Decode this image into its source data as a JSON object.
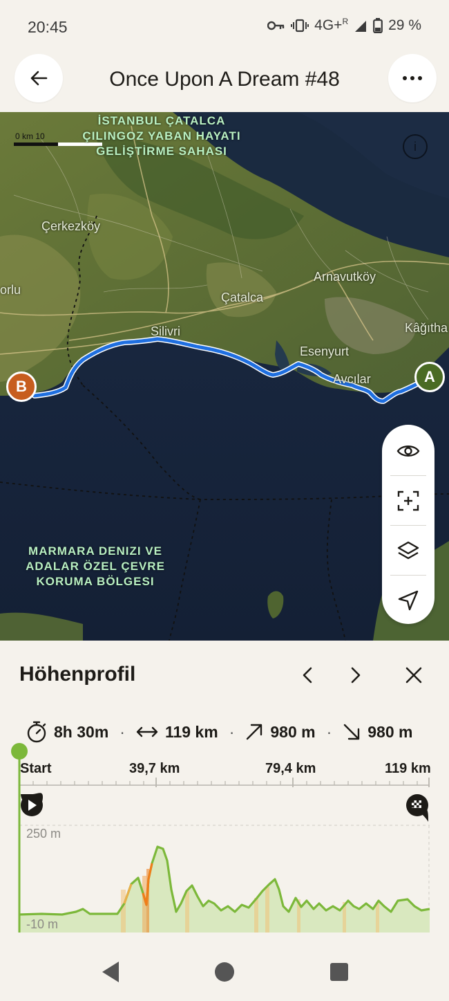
{
  "status_bar": {
    "time": "20:45",
    "network": "4G+",
    "roaming": "R",
    "battery": "29 %"
  },
  "header": {
    "title": "Once Upon A Dream #48"
  },
  "map": {
    "scale_label": "0 km   10",
    "labels": {
      "protected_area_north": "İSTANBUL ÇATALCA\nÇILINGOZ YABAN HAYATI\nGELİŞTİRME SAHASI",
      "protected_area_sea": "MARMARA DENIZI VE\nADALAR ÖZEL ÇEVRE\nKORUMA BÖLGESI"
    },
    "places": {
      "cerkezkoy": "Çerkezköy",
      "corlu": "orlu",
      "catalca": "Çatalca",
      "arnavutkoy": "Arnavutköy",
      "silivri": "Silivri",
      "esenyurt": "Esenyurt",
      "avcilar": "Avcılar",
      "kagithane": "Kâğıtha"
    },
    "markers": {
      "start": "A",
      "end": "B"
    },
    "info": "i"
  },
  "elevation": {
    "title": "Höhenprofil",
    "stats": {
      "duration": "8h 30m",
      "distance": "119 km",
      "ascent": "980 m",
      "descent": "980 m"
    },
    "axis": [
      "Start",
      "39,7 km",
      "79,4 km",
      "119 km"
    ],
    "y_labels": {
      "max": "250 m",
      "min": "-10 m"
    },
    "colors": {
      "profile": "#7cb83a",
      "fill": "#d9e8bf",
      "steep": "#f07d1a",
      "moderate": "#e8b04a"
    }
  }
}
